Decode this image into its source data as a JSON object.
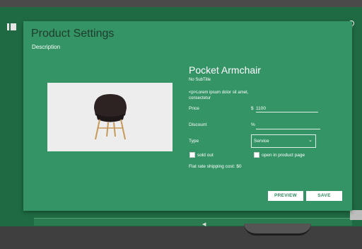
{
  "dialog": {
    "title": "Product Settings",
    "tab": "Description"
  },
  "product": {
    "name": "Pocket Armchair",
    "subtitle": "No SubTitle",
    "body_text": "<p>Lorem ipsum dolor sit amet, consectetur"
  },
  "form": {
    "price_label": "Price",
    "price_prefix": "$",
    "price_value": "1100",
    "discount_label": "Discount",
    "discount_prefix": "%",
    "discount_value": "",
    "type_label": "Type",
    "type_value": "Service",
    "sold_out_label": "sold out",
    "open_in_page_label": "open in product page",
    "shipping_text": "Flat rate shipping cost: $0"
  },
  "buttons": {
    "preview": "PREVIEW",
    "save": "SAVE"
  },
  "icons": {
    "left_sidebar": "sidebar-toggle-icon",
    "top_right": "lightbulb-icon",
    "select": "chevron-down-icon"
  },
  "colors": {
    "dialog_bg": "#349466",
    "page_bg": "#1f6a43",
    "button_text": "#2c8a5c"
  }
}
